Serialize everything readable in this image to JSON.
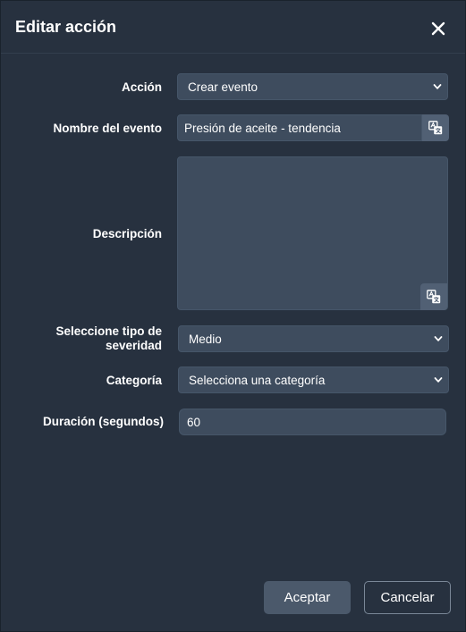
{
  "dialog": {
    "title": "Editar acción"
  },
  "form": {
    "action": {
      "label": "Acción",
      "value": "Crear evento"
    },
    "event_name": {
      "label": "Nombre del evento",
      "value": "Presión de aceite - tendencia"
    },
    "description": {
      "label": "Descripción",
      "value": ""
    },
    "severity": {
      "label": "Seleccione tipo de severidad",
      "value": "Medio"
    },
    "category": {
      "label": "Categoría",
      "value": "Selecciona una categoría"
    },
    "duration": {
      "label": "Duración (segundos)",
      "value": "60"
    }
  },
  "buttons": {
    "accept": "Aceptar",
    "cancel": "Cancelar"
  },
  "icons": {
    "close": "close-icon",
    "translate": "translate-icon",
    "chevron": "chevron-down-icon"
  },
  "colors": {
    "dialog_bg": "#27313f",
    "field_bg": "#3e4c5e",
    "button_bg": "#4b596b"
  }
}
